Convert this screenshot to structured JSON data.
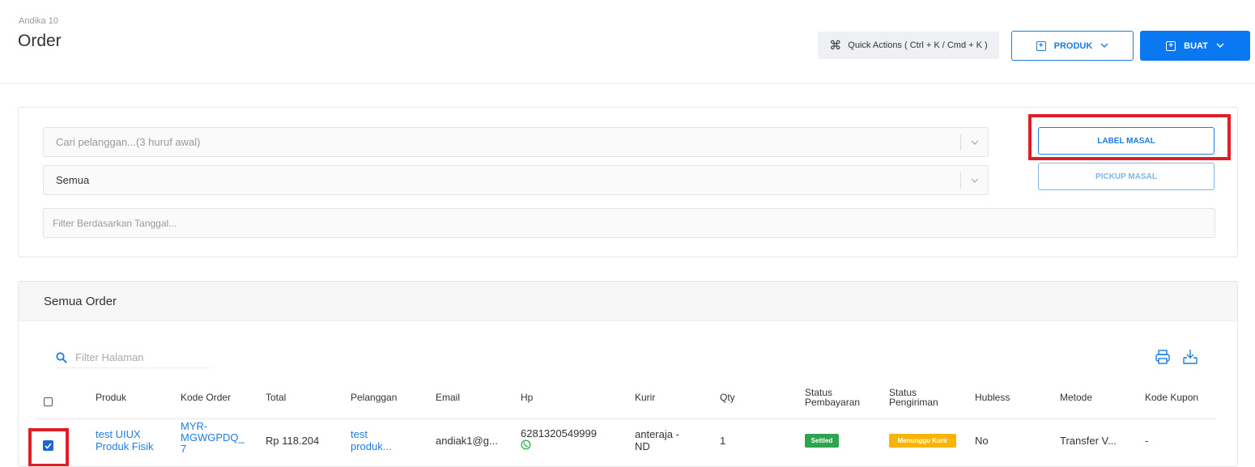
{
  "header": {
    "breadcrumb": "Andika 10",
    "title": "Order",
    "quick_actions_label": "Quick Actions ( Ctrl + K / Cmd + K )",
    "produk_label": "PRODUK",
    "buat_label": "BUAT"
  },
  "filters": {
    "customer_placeholder": "Cari pelanggan...(3 huruf awal)",
    "status_value": "Semua",
    "date_placeholder": "Filter Berdasarkan Tanggal...",
    "label_masal": "LABEL MASAL",
    "pickup_masal": "PICKUP MASAL"
  },
  "orders": {
    "title": "Semua Order",
    "search_placeholder": "Filter Halaman",
    "columns": {
      "produk": "Produk",
      "kode_order": "Kode Order",
      "total": "Total",
      "pelanggan": "Pelanggan",
      "email": "Email",
      "hp": "Hp",
      "kurir": "Kurir",
      "qty": "Qty",
      "status_pembayaran_1": "Status",
      "status_pembayaran_2": "Pembayaran",
      "status_pengiriman_1": "Status",
      "status_pengiriman_2": "Pengiriman",
      "hubless": "Hubless",
      "metode": "Metode",
      "kode_kupon": "Kode Kupon"
    },
    "rows": [
      {
        "produk_1": "test UIUX",
        "produk_2": "Produk Fisik",
        "kode_order_1": "MYR-",
        "kode_order_2": "MGWGPDQ_",
        "kode_order_3": "7",
        "total": "Rp 118.204",
        "pelanggan_1": "test",
        "pelanggan_2": "produk...",
        "email": "andiak1@g...",
        "hp": "6281320549999",
        "kurir_1": "anteraja -",
        "kurir_2": "ND",
        "qty": "1",
        "status_pembayaran": "Settled",
        "status_pengiriman": "Menunggu Kurir",
        "hubless": "No",
        "metode": "Transfer V...",
        "kode_kupon": "-"
      }
    ]
  },
  "colors": {
    "primary": "#0a78f0",
    "highlight": "#e01e25",
    "settled": "#2ea44f",
    "waiting": "#f7b500"
  }
}
